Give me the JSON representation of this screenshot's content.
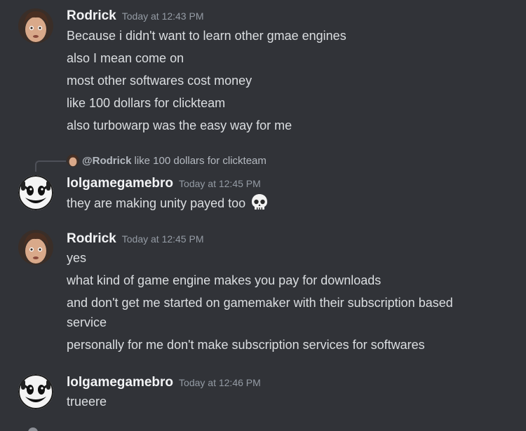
{
  "messages": [
    {
      "username": "Rodrick",
      "timestamp": "Today at 12:43 PM",
      "lines": [
        "Because i didn't want to learn other gmae engines",
        "also I mean come on",
        "most other softwares cost money",
        "like 100 dollars for clickteam",
        "also turbowarp was the easy way for me"
      ]
    },
    {
      "reply": {
        "user": "@Rodrick",
        "text": "like 100 dollars for clickteam"
      },
      "username": "lolgamegamebro",
      "timestamp": "Today at 12:45 PM",
      "lines": [
        "they are making unity payed too"
      ],
      "emoji": "skull-emoji"
    },
    {
      "username": "Rodrick",
      "timestamp": "Today at 12:45 PM",
      "lines": [
        "yes",
        "what kind of game engine makes you pay for downloads",
        "and don't get me started on gamemaker with their subscription based service",
        "personally for me don't make subscription services for softwares"
      ]
    },
    {
      "username": "lolgamegamebro",
      "timestamp": "Today at 12:46 PM",
      "lines": [
        "trueere"
      ]
    }
  ],
  "colors": {
    "background": "#313338",
    "username": "#f2f3f5",
    "timestamp": "#949ba4",
    "text": "#dbdee1"
  }
}
